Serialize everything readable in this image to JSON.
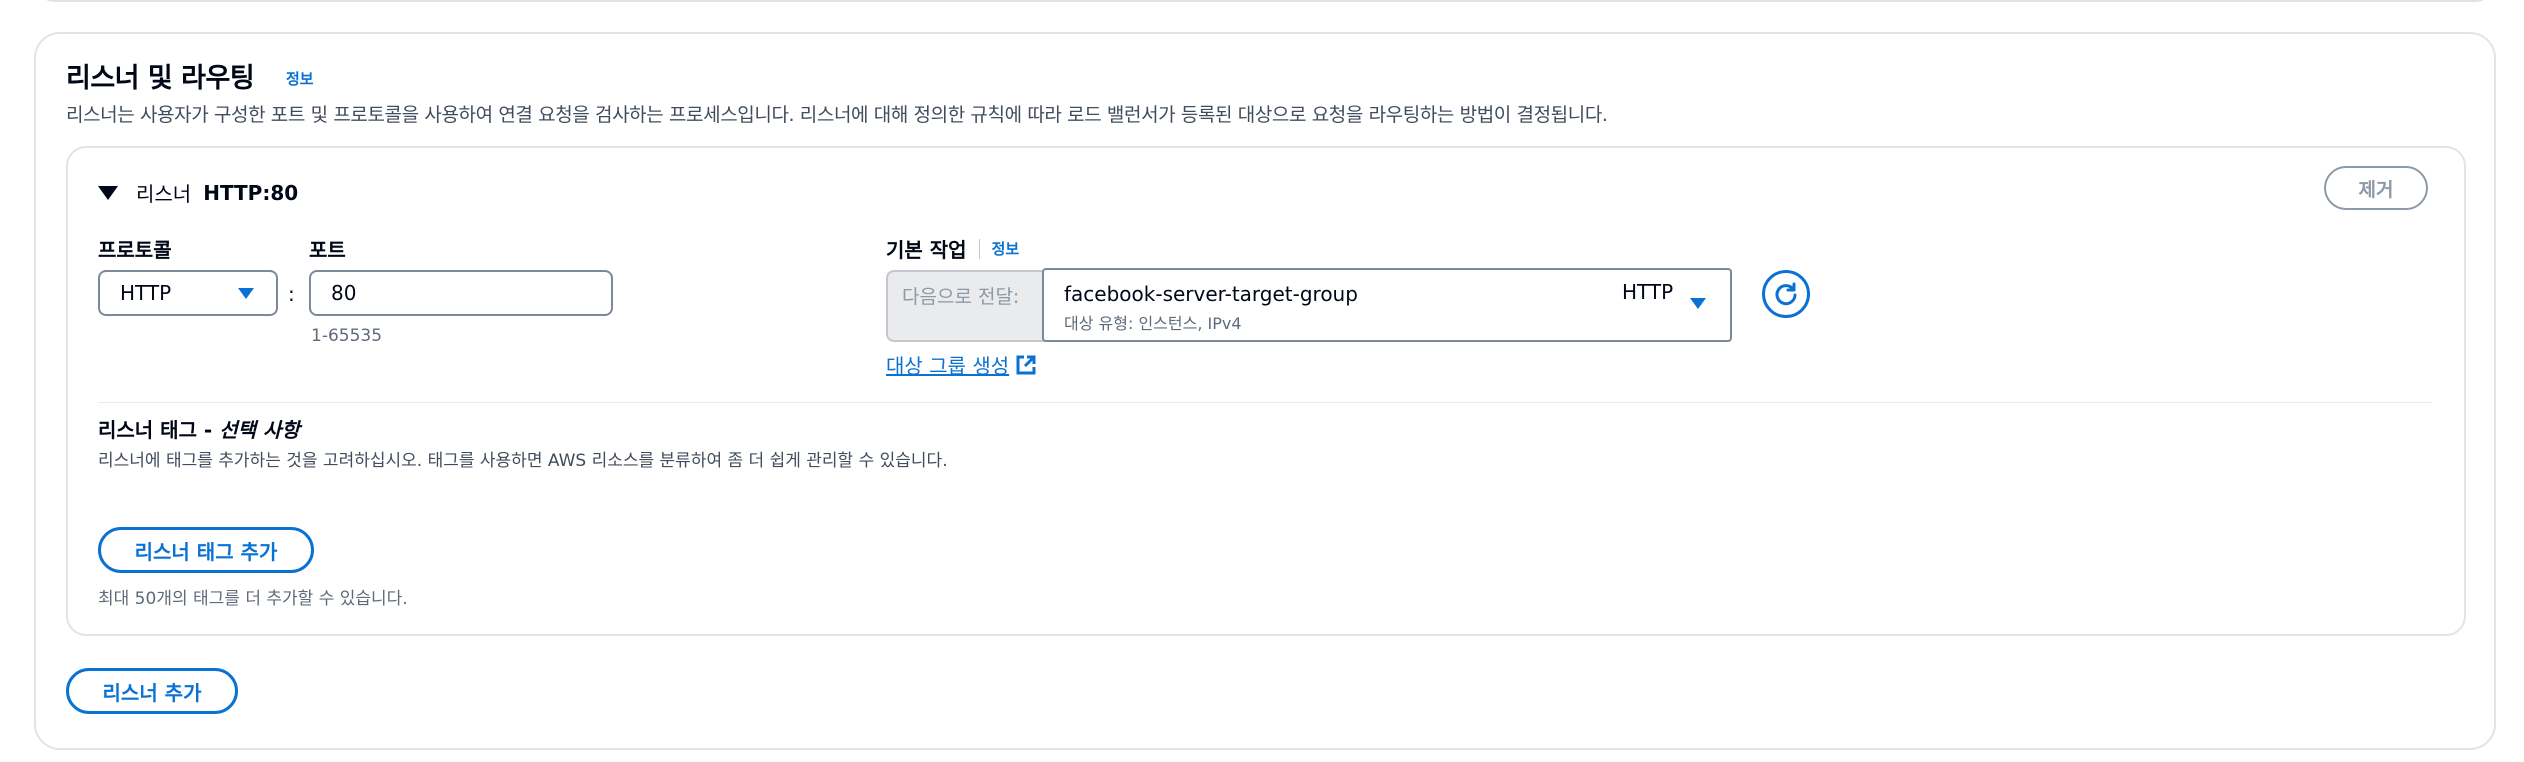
{
  "section": {
    "title": "리스너 및 라우팅",
    "info": "정보",
    "description": "리스너는 사용자가 구성한 포트 및 프로토콜을 사용하여 연결 요청을 검사하는 프로세스입니다. 리스너에 대해 정의한 규칙에 따라 로드 밸런서가 등록된 대상으로 요청을 라우팅하는 방법이 결정됩니다."
  },
  "listener": {
    "label": "리스너",
    "value": "HTTP:80",
    "remove_label": "제거",
    "protocol_label": "프로토콜",
    "protocol_value": "HTTP",
    "port_label": "포트",
    "port_value": "80",
    "port_hint": "1-65535",
    "default_action_label": "기본 작업",
    "default_action_info": "정보",
    "forward_label": "다음으로 전달:",
    "target_group_name": "facebook-server-target-group",
    "target_group_sub": "대상 유형: 인스턴스, IPv4",
    "target_group_protocol": "HTTP",
    "create_target_group_link": "대상 그룹 생성"
  },
  "tags": {
    "title_main": "리스너 태그 - ",
    "title_optional": "선택 사항",
    "description": "리스너에 태그를 추가하는 것을 고려하십시오. 태그를 사용하면 AWS 리소스를 분류하여 좀 더 쉽게 관리할 수 있습니다.",
    "add_button": "리스너 태그 추가",
    "limit_hint": "최대 50개의 태그를 더 추가할 수 있습니다."
  },
  "add_listener_button": "리스너 추가",
  "colors": {
    "accent": "#0972d3",
    "border": "#7d8998",
    "disabled": "#8d99a8"
  },
  "icons": [
    "caret-down-icon",
    "select-caret-icon",
    "refresh-icon",
    "external-link-icon"
  ]
}
